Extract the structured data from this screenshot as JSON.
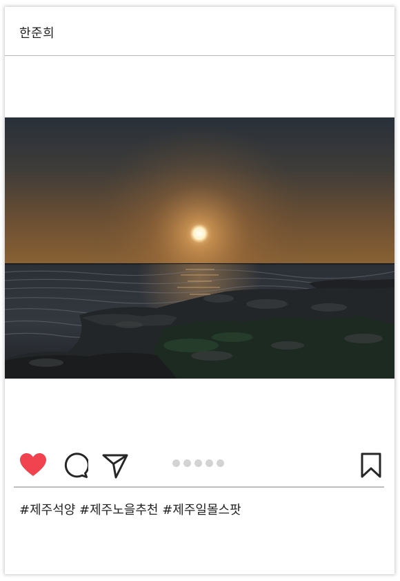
{
  "post": {
    "username": "한준희",
    "hashtags": "#제주석양 #제주노을추천 #제주일몰스팟",
    "carousel": {
      "total": 5
    }
  },
  "icons": {
    "like": "heart-icon",
    "comment": "speech-bubble-icon",
    "share": "paper-plane-icon",
    "save": "bookmark-icon"
  },
  "colors": {
    "like_active": "#f0434f",
    "icon_stroke": "#262626",
    "dot_inactive": "#d3d3d3",
    "divider": "#bdbdbd"
  }
}
